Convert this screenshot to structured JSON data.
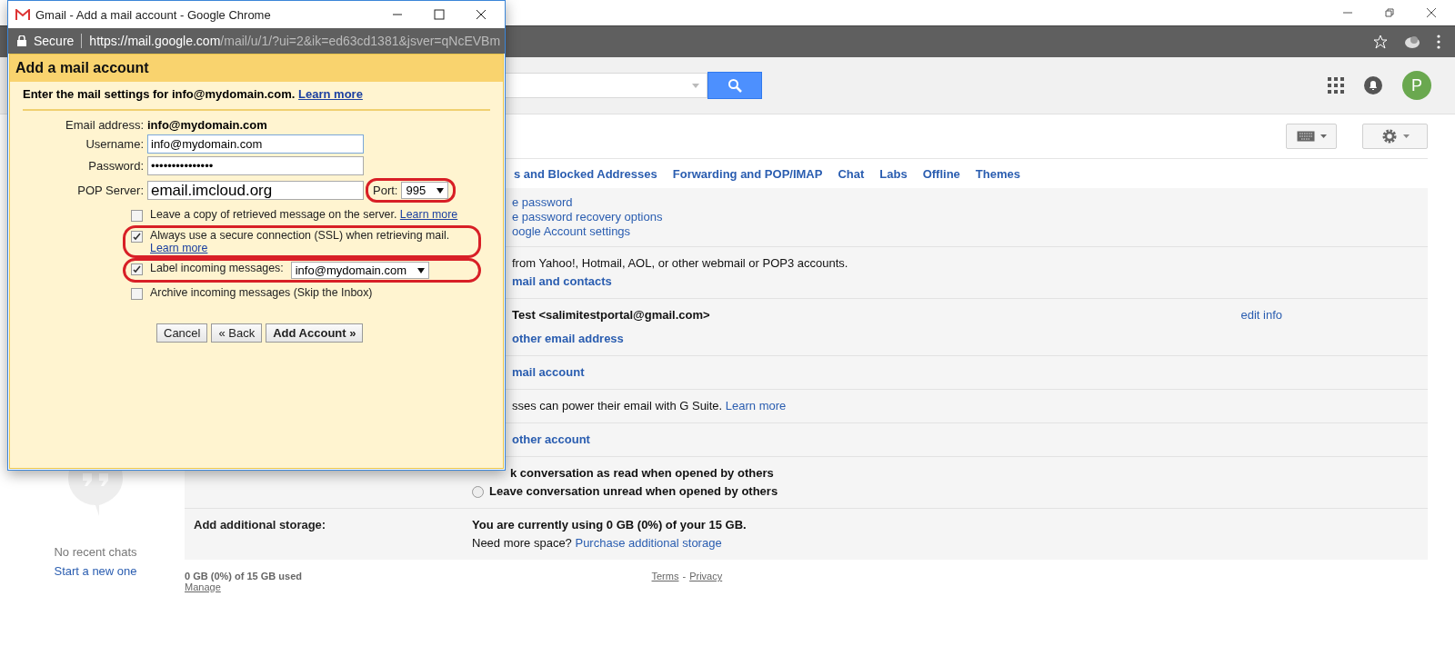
{
  "header": {
    "avatar": "P"
  },
  "settings": {
    "tabs": [
      "s and Blocked Addresses",
      "Forwarding and POP/IMAP",
      "Chat",
      "Labs",
      "Offline",
      "Themes"
    ],
    "rows": [
      {
        "lines": [
          {
            "kind": "link",
            "text": "e password"
          },
          {
            "kind": "link",
            "text": "e password recovery options"
          },
          {
            "kind": "link",
            "text": "oogle Account settings"
          }
        ]
      },
      {
        "lines": [
          {
            "kind": "text",
            "text": "from Yahoo!, Hotmail, AOL, or other webmail or POP3 accounts."
          },
          {
            "kind": "action",
            "text": "mail and contacts"
          }
        ]
      },
      {
        "lines": [
          {
            "kind": "strong",
            "text": "Test <salimitestportal@gmail.com>"
          },
          {
            "kind": "action",
            "text": "other email address"
          }
        ],
        "aside": "edit info"
      },
      {
        "lines": [
          {
            "kind": "action",
            "text": "mail account"
          }
        ]
      },
      {
        "lines": [
          {
            "kind": "text",
            "text": "sses can power their email with G Suite.",
            "link": "Learn more"
          }
        ]
      },
      {
        "lines": [
          {
            "kind": "action",
            "text": "other account"
          }
        ]
      },
      {
        "lines": [
          {
            "kind": "strong",
            "text": "k conversation as read when opened by others"
          },
          {
            "kind": "radio",
            "text": "Leave conversation unread when opened by others",
            "selected": false
          }
        ]
      },
      {
        "label": "Add additional storage:",
        "lines": [
          {
            "kind": "strong",
            "text": "You are currently using 0 GB (0%) of your 15 GB."
          },
          {
            "kind": "text",
            "text": "Need more space?",
            "link": "Purchase additional storage"
          }
        ]
      }
    ]
  },
  "chat": {
    "empty": "No recent chats",
    "start": "Start a new one"
  },
  "footer": {
    "usage": "0 GB (0%) of 15 GB used",
    "manage": "Manage",
    "terms": "Terms",
    "separator": "-",
    "privacy": "Privacy"
  },
  "popup": {
    "title": "Gmail - Add a mail account - Google Chrome",
    "secure": "Secure",
    "url_host": "https://mail.google.com",
    "url_path": "/mail/u/1/?ui=2&ik=ed63cd1381&jsver=qNcEVBm",
    "heading": "Add a mail account",
    "intro": "Enter the mail settings for info@mydomain.com.",
    "intro_link": "Learn more",
    "fields": [
      {
        "kind": "static",
        "label": "Email address:",
        "value": "info@mydomain.com"
      },
      {
        "kind": "input",
        "label": "Username:",
        "value": "info@mydomain.com"
      },
      {
        "kind": "input",
        "label": "Password:",
        "value": "•••••••••••••••"
      },
      {
        "kind": "server",
        "label": "POP Server:",
        "value": "email.imcloud.org",
        "port_label": "Port:",
        "port": "995",
        "highlighted": true
      }
    ],
    "options": [
      {
        "label": "Leave a copy of retrieved message on the server.",
        "link": "Learn more",
        "checked": false,
        "highlighted": false
      },
      {
        "label": "Always use a secure connection (SSL) when retrieving mail.",
        "link": "Learn more",
        "checked": true,
        "highlighted": true
      },
      {
        "label": "Label incoming messages:",
        "select": "info@mydomain.com",
        "checked": true,
        "highlighted": true
      },
      {
        "label": "Archive incoming messages (Skip the Inbox)",
        "checked": false,
        "highlighted": false
      }
    ],
    "buttons": [
      {
        "label": "Cancel",
        "primary": false
      },
      {
        "label": "« Back",
        "primary": false
      },
      {
        "label": "Add Account »",
        "primary": true
      }
    ]
  }
}
